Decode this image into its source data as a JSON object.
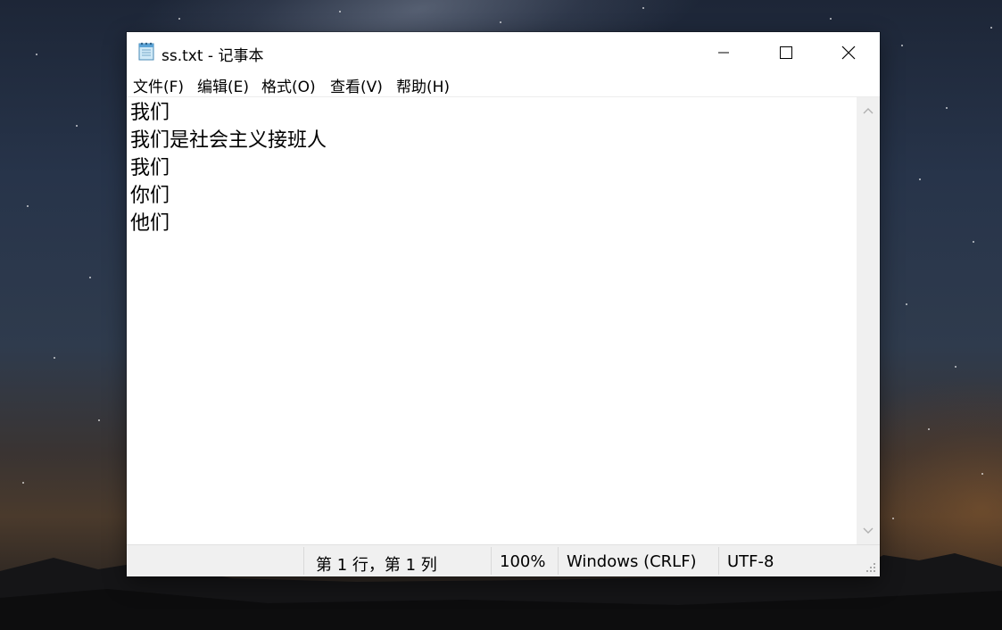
{
  "window": {
    "title": "ss.txt - 记事本",
    "app_icon": "notepad-icon",
    "controls": {
      "minimize_icon": "minimize-icon",
      "maximize_icon": "maximize-icon",
      "close_icon": "close-icon"
    }
  },
  "menubar": {
    "items": [
      {
        "label": "文件(F)"
      },
      {
        "label": "编辑(E)"
      },
      {
        "label": "格式(O)"
      },
      {
        "label": "查看(V)"
      },
      {
        "label": "帮助(H)"
      }
    ]
  },
  "editor": {
    "lines": [
      "我们",
      "我们是社会主义接班人",
      "我们",
      "你们",
      "他们"
    ]
  },
  "statusbar": {
    "position": "第 1 行，第 1 列",
    "zoom": "100%",
    "line_ending": "Windows (CRLF)",
    "encoding": "UTF-8"
  },
  "colors": {
    "window_bg": "#ffffff",
    "statusbar_bg": "#f0f0f0",
    "scrollbar_bg": "#f0f0f0",
    "text": "#000000"
  }
}
